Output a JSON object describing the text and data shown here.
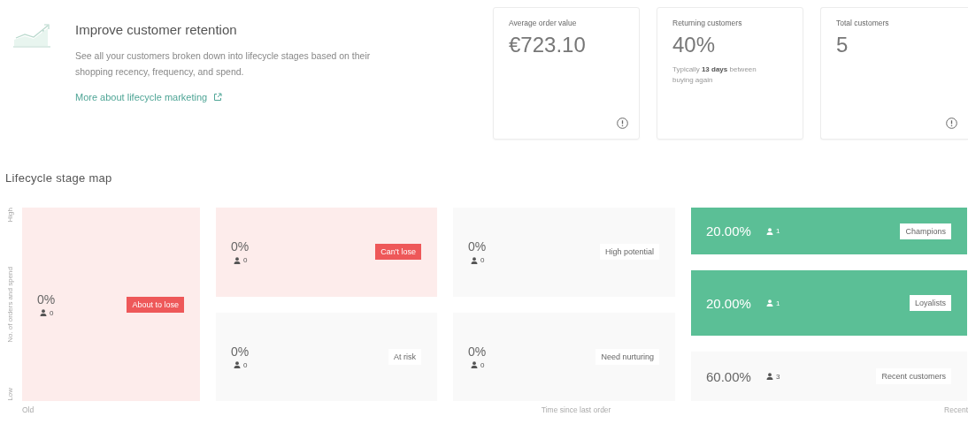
{
  "intro": {
    "title": "Improve customer retention",
    "text": "See all your customers broken down into lifecycle stages based on their shopping recency, frequency, and spend.",
    "link": "More about lifecycle marketing"
  },
  "stats": [
    {
      "label": "Average order value",
      "value": "€723.10",
      "info": true
    },
    {
      "label": "Returning customers",
      "value": "40%",
      "note": "Typically **13 days** between buying again",
      "info": false
    },
    {
      "label": "Total customers",
      "value": "5",
      "info": true
    }
  ],
  "map": {
    "title": "Lifecycle stage map",
    "y_axis": {
      "high": "High",
      "label": "No. of orders and spend",
      "low": "Low"
    },
    "x_axis": {
      "old": "Old",
      "label": "Time since last order",
      "recent": "Recent"
    },
    "columns": [
      {
        "kind": "stacked",
        "cells": [
          {
            "share": "0%",
            "count": "0",
            "stage": "About to lose",
            "kind": "alert"
          }
        ]
      },
      {
        "kind": "stacked",
        "cells": [
          {
            "share": "0%",
            "count": "0",
            "stage": "Can't lose",
            "kind": "alert"
          },
          {
            "share": "0%",
            "count": "0",
            "stage": "At risk",
            "kind": "plain"
          }
        ]
      },
      {
        "kind": "stacked",
        "cells": [
          {
            "share": "0%",
            "count": "0",
            "stage": "High potential",
            "kind": "plain"
          },
          {
            "share": "0%",
            "count": "0",
            "stage": "Need nurturing",
            "kind": "plain"
          }
        ]
      },
      {
        "kind": "inline",
        "cells": [
          {
            "share": "20.00%",
            "count": "1",
            "stage": "Champions",
            "kind": "good"
          },
          {
            "share": "20.00%",
            "count": "1",
            "stage": "Loyalists",
            "kind": "good"
          },
          {
            "share": "60.00%",
            "count": "3",
            "stage": "Recent customers",
            "kind": "plain"
          }
        ]
      }
    ]
  }
}
